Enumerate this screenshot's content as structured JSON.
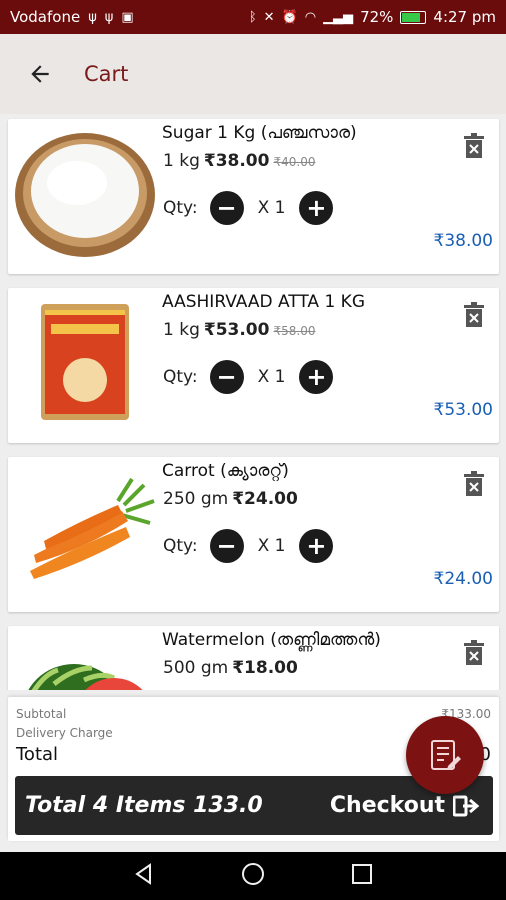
{
  "status_bar": {
    "carrier": "Vodafone",
    "battery": "72%",
    "time": "4:27 pm"
  },
  "app_bar": {
    "title": "Cart"
  },
  "items": [
    {
      "name": "Sugar 1 Kg (പഞ്ചസാര)",
      "unit": "1 kg",
      "price": "₹38.00",
      "mrp": "₹40.00",
      "qty_label": "Qty:",
      "qty": "X 1",
      "total": "₹38.00",
      "image": "sugar-bowl-image"
    },
    {
      "name": "AASHIRVAAD ATTA 1 KG",
      "unit": "1 kg",
      "price": "₹53.00",
      "mrp": "₹58.00",
      "qty_label": "Qty:",
      "qty": "X 1",
      "total": "₹53.00",
      "image": "atta-pack-image"
    },
    {
      "name": "Carrot  (ക്യാരറ്റ്)",
      "unit": "250 gm",
      "price": "₹24.00",
      "qty_label": "Qty:",
      "qty": "X 1",
      "total": "₹24.00",
      "image": "carrot-image"
    },
    {
      "name": "Watermelon (തണ്ണിമത്തൻ)",
      "unit": "500 gm",
      "price": "₹18.00",
      "image": "watermelon-image"
    }
  ],
  "summary": {
    "subtotal_label": "Subtotal",
    "subtotal_value": "₹133.00",
    "delivery_label": "Delivery Charge",
    "total_label": "Total",
    "total_value": "0"
  },
  "checkout": {
    "items_text": "Total 4 Items 133.0",
    "button_label": "Checkout"
  },
  "colors": {
    "status_bar": "#6b0c0c",
    "accent": "#7c1212",
    "price_total": "#1a5fb4",
    "checkout_bar": "#272727"
  }
}
